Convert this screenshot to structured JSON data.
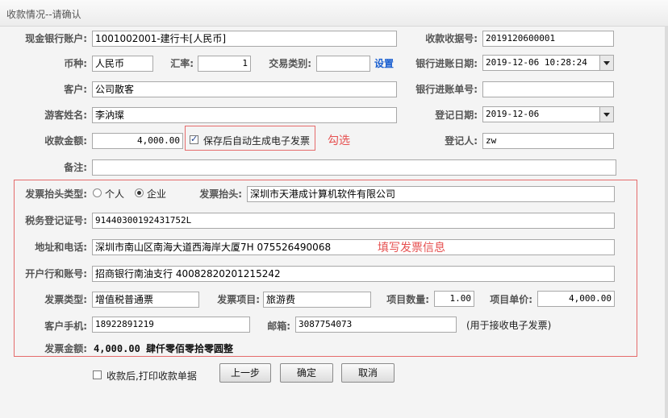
{
  "window": {
    "title": "收款情况--请确认"
  },
  "form": {
    "bank_account_label": "现金银行账户:",
    "bank_account_value": "1001002001-建行卡[人民币]",
    "receipt_no_label": "收款收据号:",
    "receipt_no_value": "2019120600001",
    "currency_label": "币种:",
    "currency_value": "人民币",
    "rate_label": "汇率:",
    "rate_value": "1",
    "trade_type_label": "交易类别:",
    "trade_type_value": "",
    "settings_link": "设置",
    "bank_date_label": "银行进账日期:",
    "bank_date_value": "2019-12-06 10:28:24",
    "customer_label": "客户:",
    "customer_value": "公司散客",
    "bank_slip_label": "银行进账单号:",
    "bank_slip_value": "",
    "tourist_label": "游客姓名:",
    "tourist_value": "李汭璨",
    "register_date_label": "登记日期:",
    "register_date_value": "2019-12-06",
    "amount_label": "收款金额:",
    "amount_value": "4,000.00",
    "auto_invoice_label": "保存后自动生成电子发票",
    "auto_invoice_checked": true,
    "registrar_label": "登记人:",
    "registrar_value": "zw",
    "remark_label": "备注:",
    "remark_value": ""
  },
  "invoice": {
    "title_type_label": "发票抬头类型:",
    "radio_personal": "个人",
    "radio_company": "企业",
    "selected": "企业",
    "title_label": "发票抬头:",
    "title_value": "深圳市天港成计算机软件有限公司",
    "tax_id_label": "税务登记证号:",
    "tax_id_value": "91440300192431752L",
    "address_label": "地址和电话:",
    "address_value": "深圳市南山区南海大道西海岸大厦7H 075526490068",
    "bank_label": "开户行和账号:",
    "bank_value": "招商银行南油支行 40082820201215242",
    "invoice_type_label": "发票类型:",
    "invoice_type_value": "增值税普通票",
    "item_label": "发票项目:",
    "item_value": "旅游费",
    "qty_label": "项目数量:",
    "qty_value": "1.00",
    "unit_price_label": "项目单价:",
    "unit_price_value": "4,000.00",
    "phone_label": "客户手机:",
    "phone_value": "18922891219",
    "email_label": "邮箱:",
    "email_value": "3087754073",
    "email_hint": "(用于接收电子发票)",
    "total_label": "发票金额:",
    "total_value": "4,000.00 肆仟零佰零拾零圆整"
  },
  "annotations": {
    "check_note": "勾选",
    "fill_note": "填写发票信息",
    "color": "#e65050"
  },
  "footer": {
    "print_label": "收款后,打印收款单据",
    "print_checked": false,
    "prev_button": "上一步",
    "ok_button": "确定",
    "cancel_button": "取消"
  }
}
